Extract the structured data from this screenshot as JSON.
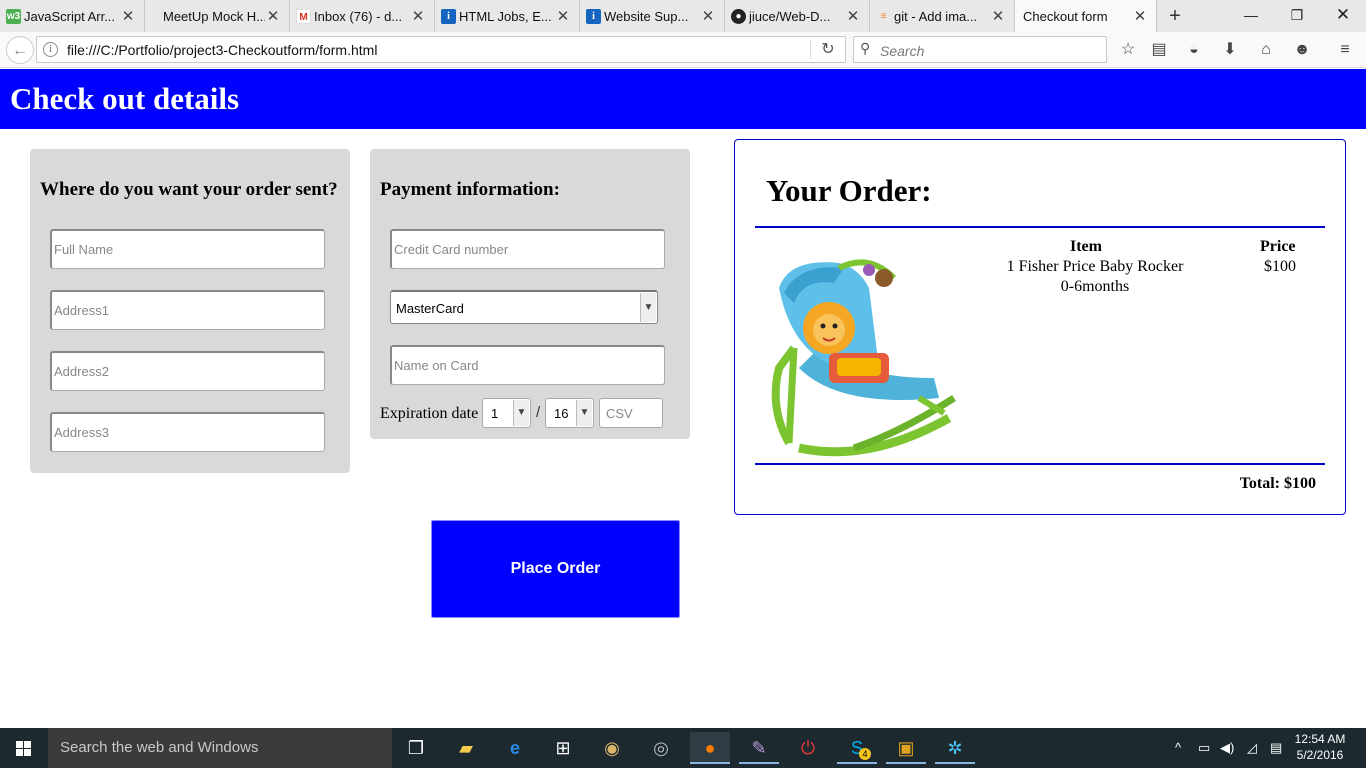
{
  "browser": {
    "tabs": [
      {
        "title": "JavaScript Arr...",
        "icon": "w3-icon",
        "color": "#4caf50"
      },
      {
        "title": "MeetUp Mock H...",
        "icon": "blank-icon",
        "color": ""
      },
      {
        "title": "Inbox (76) - d...",
        "icon": "gmail-icon",
        "color": "#d93025"
      },
      {
        "title": "HTML Jobs, E...",
        "icon": "info-icon",
        "color": "#1565c0"
      },
      {
        "title": "Website Sup...",
        "icon": "info-icon",
        "color": "#1565c0"
      },
      {
        "title": "jiuce/Web-D...",
        "icon": "github-icon",
        "color": "#222222"
      },
      {
        "title": "git - Add ima...",
        "icon": "stackoverflow-icon",
        "color": "#f48024"
      },
      {
        "title": "Checkout form",
        "icon": "",
        "color": "",
        "active": true
      }
    ],
    "new_tab_label": "+",
    "url": "file:///C:/Portfolio/project3-Checkoutform/form.html",
    "search_placeholder": "Search"
  },
  "page": {
    "header_title": "Check out details",
    "shipping": {
      "heading": "Where do you want your order sent?",
      "full_name_placeholder": "Full Name",
      "address1_placeholder": "Address1",
      "address2_placeholder": "Address2",
      "address3_placeholder": "Address3"
    },
    "payment": {
      "heading": "Payment information:",
      "card_number_placeholder": "Credit Card number",
      "card_type_selected": "MasterCard",
      "name_on_card_placeholder": "Name on Card",
      "expiration_label": "Expiration date",
      "exp_month": "1",
      "exp_separator": "/",
      "exp_year": "16",
      "csv_placeholder": "CSV"
    },
    "order": {
      "heading": "Your Order:",
      "item_header": "Item",
      "price_header": "Price",
      "item_line1": "1 Fisher Price Baby Rocker",
      "item_line2": "0-6months",
      "price": "$100",
      "total": "Total: $100"
    },
    "place_order_label": "Place Order"
  },
  "taskbar": {
    "search_placeholder": "Search the web and Windows",
    "time": "12:54 AM",
    "date": "5/2/2016",
    "skype_badge": "4"
  },
  "colors": {
    "header_bg": "#0000ff",
    "button_bg": "#0000ff",
    "order_border": "#0000cc",
    "panel_bg": "#dad9d9"
  }
}
